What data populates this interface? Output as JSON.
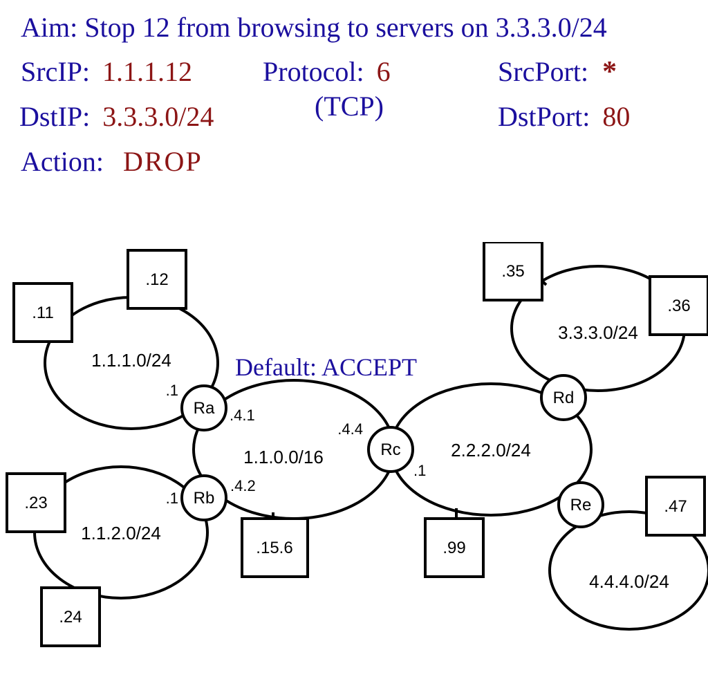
{
  "rule": {
    "aim_label": "Aim:",
    "aim_text": "Stop 12 from browsing to servers on 3.3.3.0/24",
    "srcip_label": "SrcIP:",
    "srcip_value": "1.1.1.12",
    "protocol_label": "Protocol:",
    "protocol_value": "6",
    "protocol_note": "(TCP)",
    "srcport_label": "SrcPort:",
    "srcport_value": "*",
    "dstip_label": "DstIP:",
    "dstip_value": "3.3.3.0/24",
    "dstport_label": "DstPort:",
    "dstport_value": "80",
    "action_label": "Action:",
    "action_value": "DROP",
    "default_label": "Default:",
    "default_value": "ACCEPT"
  },
  "nets": {
    "n1": "1.1.1.0/24",
    "n2": "1.1.2.0/24",
    "core": "1.1.0.0/16",
    "right": "2.2.2.0/24",
    "n3": "3.3.3.0/24",
    "n4": "4.4.4.0/24"
  },
  "routers": {
    "ra": "Ra",
    "rb": "Rb",
    "rc": "Rc",
    "rd": "Rd",
    "re": "Re"
  },
  "hosts": {
    "h11": ".11",
    "h12": ".12",
    "h23": ".23",
    "h24": ".24",
    "h156": ".15.6",
    "h99": ".99",
    "h35": ".35",
    "h36": ".36",
    "h47": ".47"
  },
  "iface": {
    "ra_left": ".1",
    "ra_right": ".4.1",
    "rb_left": ".1",
    "rb_right": ".4.2",
    "rc_left": ".4.4",
    "rc_right": ".1"
  }
}
